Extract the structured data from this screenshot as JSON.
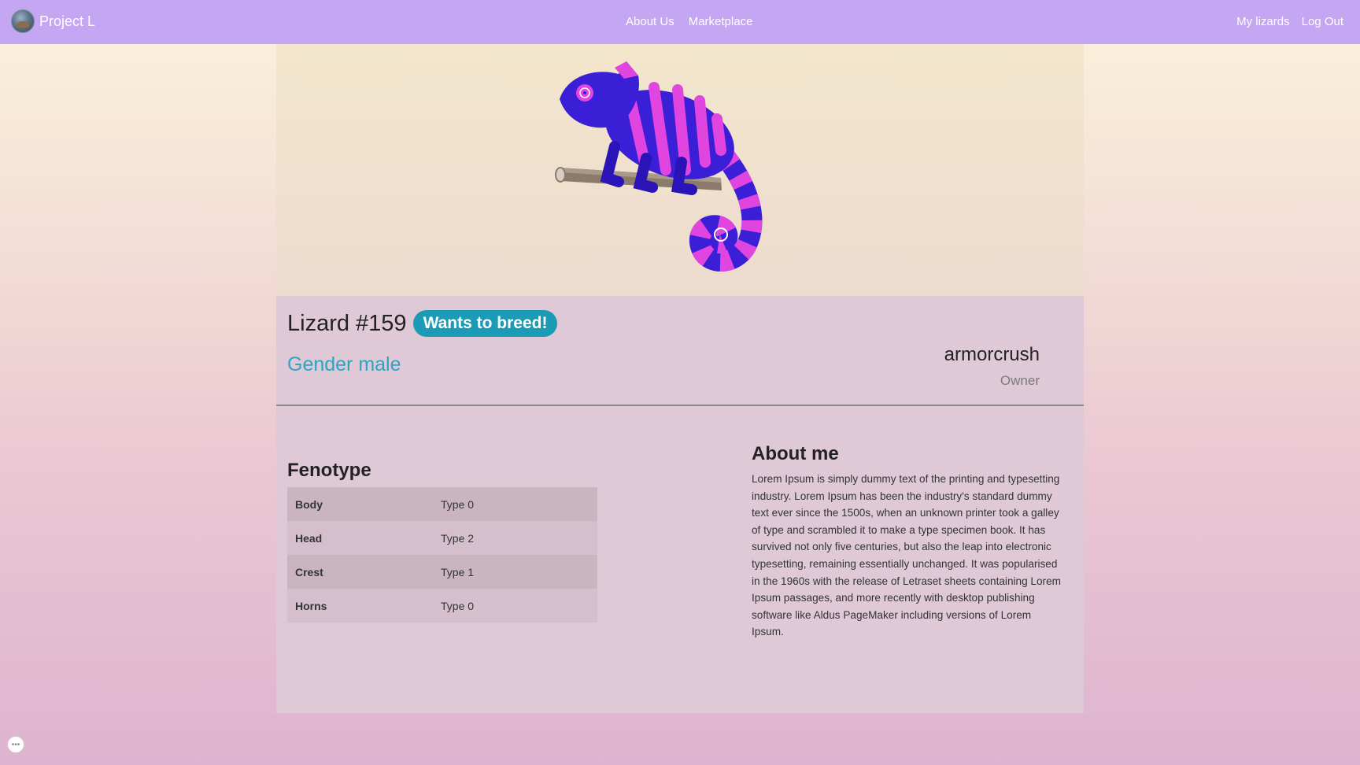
{
  "navbar": {
    "brand": "Project L",
    "center_links": [
      "About Us",
      "Marketplace"
    ],
    "right_links": [
      "My lizards",
      "Log Out"
    ],
    "background": "#c4a6f3"
  },
  "lizard": {
    "title": "Lizard #159",
    "badge": "Wants to breed!",
    "gender": "Gender male",
    "owner_name": "armorcrush",
    "owner_label": "Owner",
    "image_icon": "chameleon-illustration"
  },
  "fenotype": {
    "title": "Fenotype",
    "rows": [
      {
        "trait": "Body",
        "value": "Type 0"
      },
      {
        "trait": "Head",
        "value": "Type 2"
      },
      {
        "trait": "Crest",
        "value": "Type 1"
      },
      {
        "trait": "Horns",
        "value": "Type 0"
      }
    ]
  },
  "about": {
    "title": "About me",
    "text": "Lorem Ipsum is simply dummy text of the printing and typesetting industry. Lorem Ipsum has been the industry's standard dummy text ever since the 1500s, when an unknown printer took a galley of type and scrambled it to make a type specimen book. It has survived not only five centuries, but also the leap into electronic typesetting, remaining essentially unchanged. It was popularised in the 1960s with the release of Letraset sheets containing Lorem Ipsum passages, and more recently with desktop publishing software like Aldus PageMaker including versions of Lorem Ipsum."
  },
  "colors": {
    "badge": "#1b9bb5",
    "gender": "#2aa5c3",
    "card": "#dfc9d7"
  }
}
